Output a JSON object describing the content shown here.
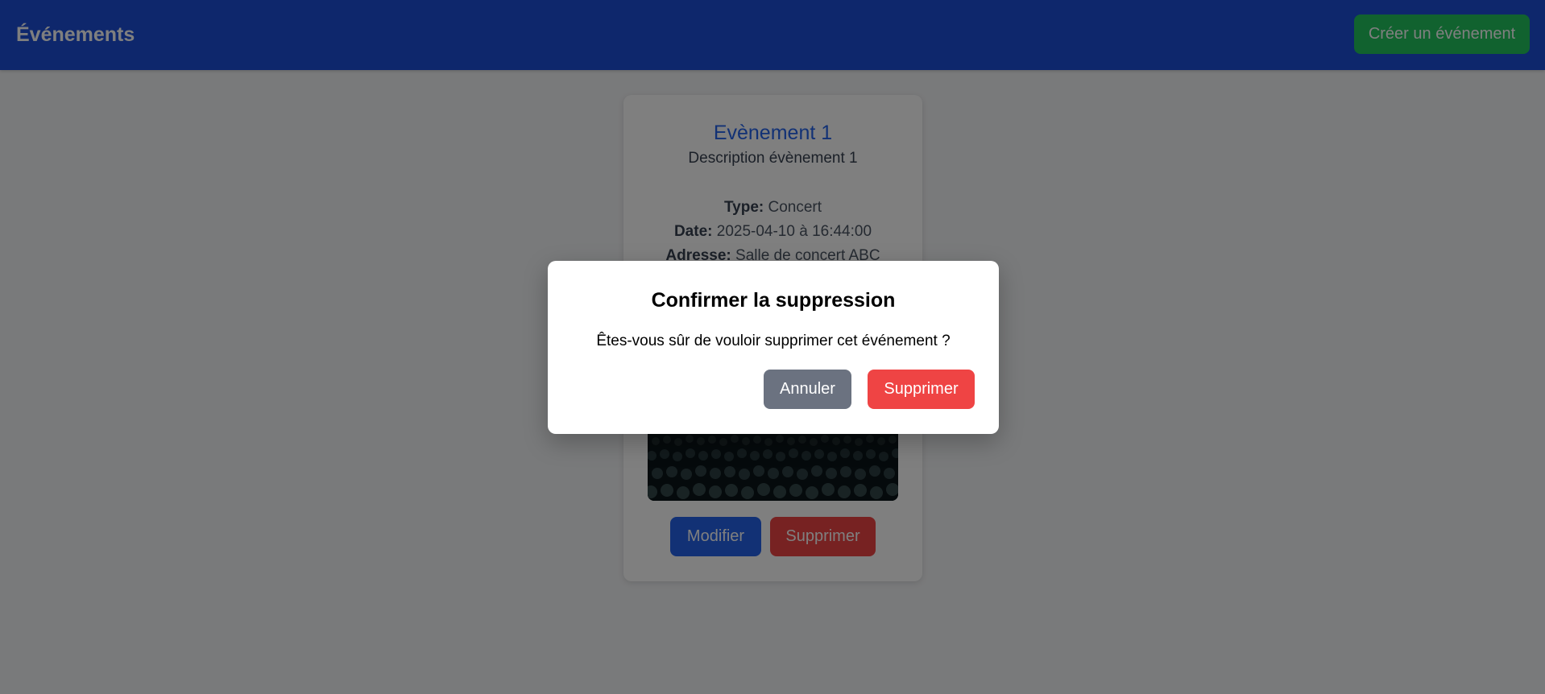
{
  "header": {
    "title": "Événements",
    "create_button": "Créer un événement"
  },
  "event_card": {
    "title": "Evènement 1",
    "description": "Description évènement 1",
    "type_label": "Type:",
    "type_value": "Concert",
    "date_label": "Date:",
    "date_value": "2025-04-10 à 16:44:00",
    "address_label": "Adresse:",
    "address_value": "Salle de concert ABC",
    "image_icon": "concert-crowd-image",
    "edit_button": "Modifier",
    "delete_button": "Supprimer"
  },
  "modal": {
    "title": "Confirmer la suppression",
    "message": "Êtes-vous sûr de vouloir supprimer cet événement ?",
    "cancel_button": "Annuler",
    "confirm_button": "Supprimer"
  },
  "colors": {
    "navbar": "#1d4ed8",
    "create_button": "#22c55e",
    "edit_button": "#2563eb",
    "delete_button": "#ef4444",
    "cancel_button": "#6b7280",
    "overlay": "rgba(0,0,0,0.5)"
  }
}
